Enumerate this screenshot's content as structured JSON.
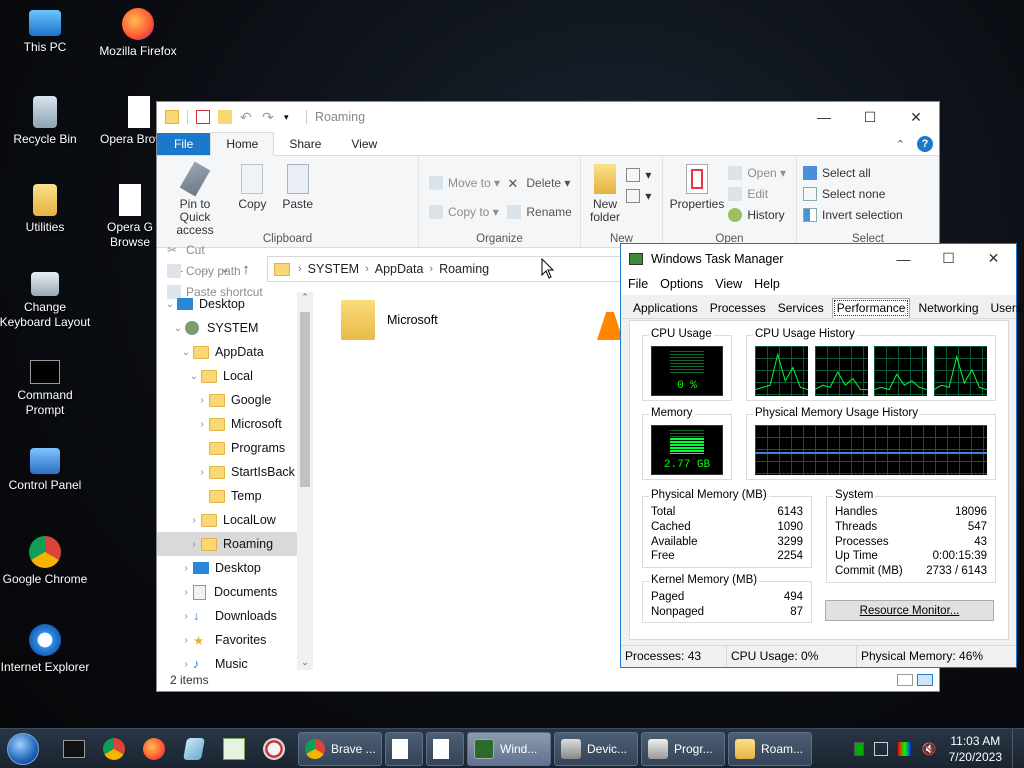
{
  "desktop": {
    "icons": [
      {
        "label": "This PC"
      },
      {
        "label": "Mozilla Firefox"
      },
      {
        "label": "Recycle Bin"
      },
      {
        "label": "Opera Brow"
      },
      {
        "label": "Utilities"
      },
      {
        "label": "Opera G Browse"
      },
      {
        "label": "Change Keyboard Layout"
      },
      {
        "label": "Command Prompt"
      },
      {
        "label": "Control Panel"
      },
      {
        "label": "Google Chrome"
      },
      {
        "label": "Internet Explorer"
      }
    ]
  },
  "explorer": {
    "title": "Roaming",
    "tabs": [
      "File",
      "Home",
      "Share",
      "View"
    ],
    "clipboard": {
      "pin": "Pin to Quick access",
      "copy": "Copy",
      "paste": "Paste",
      "cut": "Cut",
      "copy_path": "Copy path",
      "paste_shortcut": "Paste shortcut",
      "label": "Clipboard"
    },
    "organize": {
      "move_to": "Move to",
      "copy_to": "Copy to",
      "delete": "Delete",
      "rename": "Rename",
      "label": "Organize"
    },
    "new": {
      "new_folder": "New folder",
      "label": "New"
    },
    "open": {
      "properties": "Properties",
      "open": "Open",
      "edit": "Edit",
      "history": "History",
      "label": "Open"
    },
    "select": {
      "select_all": "Select all",
      "select_none": "Select none",
      "invert": "Invert selection",
      "label": "Select"
    },
    "address": [
      "SYSTEM",
      "AppData",
      "Roaming"
    ],
    "tree": [
      {
        "label": "Desktop"
      },
      {
        "label": "SYSTEM"
      },
      {
        "label": "AppData"
      },
      {
        "label": "Local"
      },
      {
        "label": "Google"
      },
      {
        "label": "Microsoft"
      },
      {
        "label": "Programs"
      },
      {
        "label": "StartIsBack"
      },
      {
        "label": "Temp"
      },
      {
        "label": "LocalLow"
      },
      {
        "label": "Roaming"
      },
      {
        "label": "Desktop"
      },
      {
        "label": "Documents"
      },
      {
        "label": "Downloads"
      },
      {
        "label": "Favorites"
      },
      {
        "label": "Music"
      }
    ],
    "files": [
      {
        "label": "Microsoft"
      }
    ],
    "status": "2 items"
  },
  "taskmgr": {
    "title": "Windows Task Manager",
    "menu": [
      "File",
      "Options",
      "View",
      "Help"
    ],
    "tabs": [
      "Applications",
      "Processes",
      "Services",
      "Performance",
      "Networking",
      "Users"
    ],
    "cpu_usage_label": "CPU Usage",
    "cpu_value": "0 %",
    "cpu_history_label": "CPU Usage History",
    "memory_label": "Memory",
    "memory_value": "2.77 GB",
    "mem_history_label": "Physical Memory Usage History",
    "physical_memory": {
      "label": "Physical Memory (MB)",
      "rows": [
        [
          "Total",
          "6143"
        ],
        [
          "Cached",
          "1090"
        ],
        [
          "Available",
          "3299"
        ],
        [
          "Free",
          "2254"
        ]
      ]
    },
    "kernel_memory": {
      "label": "Kernel Memory (MB)",
      "rows": [
        [
          "Paged",
          "494"
        ],
        [
          "Nonpaged",
          "87"
        ]
      ]
    },
    "system": {
      "label": "System",
      "rows": [
        [
          "Handles",
          "18096"
        ],
        [
          "Threads",
          "547"
        ],
        [
          "Processes",
          "43"
        ],
        [
          "Up Time",
          "0:00:15:39"
        ],
        [
          "Commit (MB)",
          "2733 / 6143"
        ]
      ]
    },
    "resource_monitor": "Resource Monitor...",
    "status": {
      "processes": "Processes: 43",
      "cpu": "CPU Usage: 0%",
      "memory": "Physical Memory: 46%"
    }
  },
  "taskbar": {
    "tasks": [
      {
        "label": "Brave ..."
      },
      {
        "label": ""
      },
      {
        "label": ""
      },
      {
        "label": "Wind..."
      },
      {
        "label": "Devic..."
      },
      {
        "label": "Progr..."
      },
      {
        "label": "Roam..."
      }
    ],
    "time": "11:03 AM",
    "date": "7/20/2023"
  }
}
